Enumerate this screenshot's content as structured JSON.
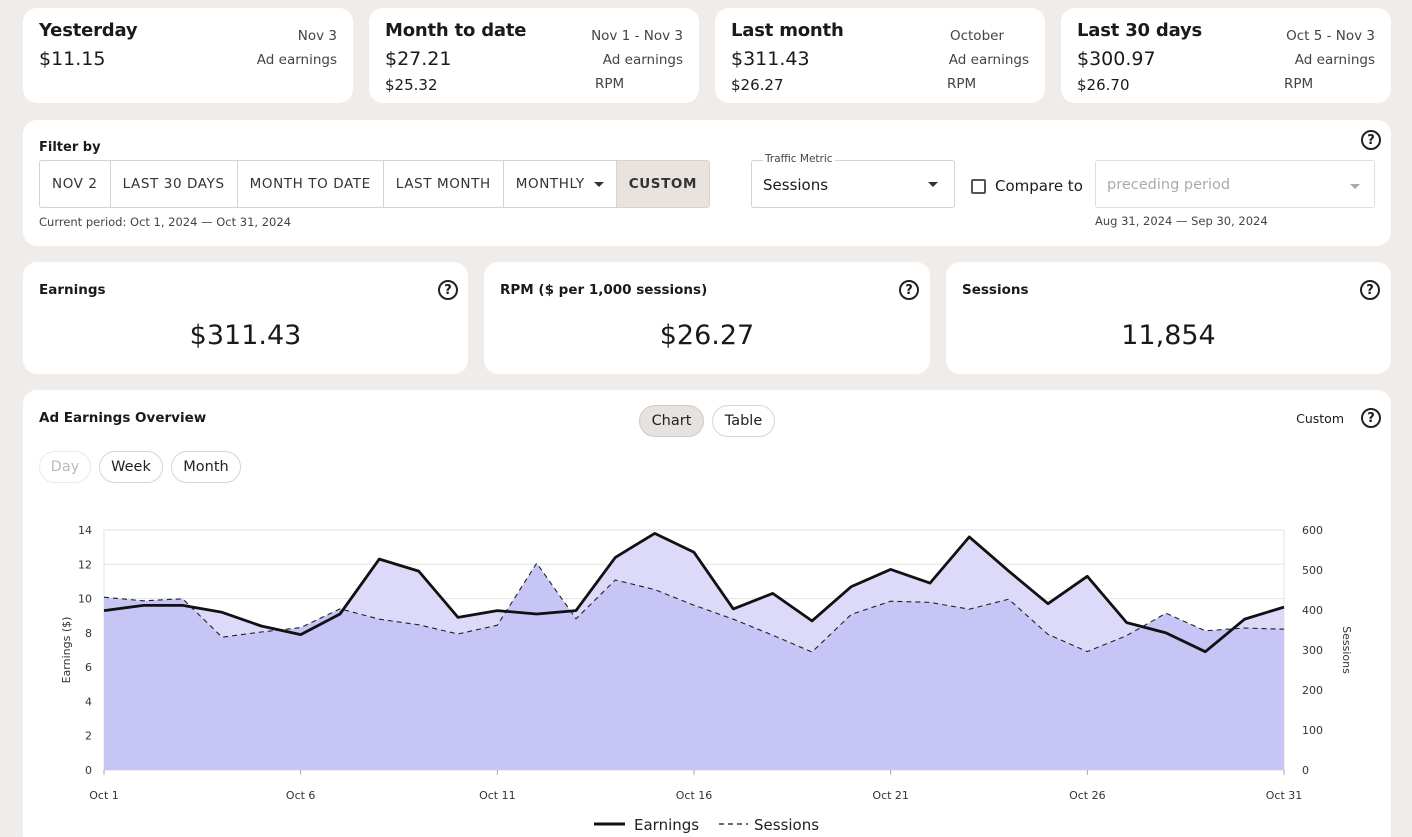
{
  "stats": [
    {
      "title": "Yesterday",
      "value1": "$11.15",
      "value2": "",
      "right0": "Nov 3",
      "right1": "Ad earnings",
      "right2": ""
    },
    {
      "title": "Month to date",
      "value1": "$27.21",
      "value2": "$25.32",
      "right0": "Nov 1 - Nov 3",
      "right1": "Ad earnings",
      "right2": "RPM"
    },
    {
      "title": "Last month",
      "value1": "$311.43",
      "value2": "$26.27",
      "right0": "October",
      "right1": "Ad earnings",
      "right2": "RPM"
    },
    {
      "title": "Last 30 days",
      "value1": "$300.97",
      "value2": "$26.70",
      "right0": "Oct 5 - Nov 3",
      "right1": "Ad earnings",
      "right2": "RPM"
    }
  ],
  "filter": {
    "label": "Filter by",
    "buttons": [
      "NOV 2",
      "LAST 30 DAYS",
      "MONTH TO DATE",
      "LAST MONTH",
      "MONTHLY",
      "CUSTOM"
    ],
    "active": "CUSTOM",
    "current_period": "Current period: Oct 1, 2024 — Oct 31, 2024",
    "traffic_metric_label": "Traffic Metric",
    "traffic_metric_value": "Sessions",
    "compare_label": "Compare to",
    "compare_placeholder": "preceding period",
    "compare_period": "Aug 31, 2024 — Sep 30, 2024",
    "help": "?"
  },
  "kpis": [
    {
      "label": "Earnings",
      "value": "$311.43",
      "help": "?"
    },
    {
      "label": "RPM ($ per 1,000 sessions)",
      "value": "$26.27",
      "help": "?"
    },
    {
      "label": "Sessions",
      "value": "11,854",
      "help": "?"
    }
  ],
  "overview": {
    "title": "Ad Earnings Overview",
    "view_tabs": [
      "Chart",
      "Table"
    ],
    "active_view": "Chart",
    "granularity": [
      "Day",
      "Week",
      "Month"
    ],
    "disabled_granularity": "Day",
    "range_label": "Custom",
    "help": "?"
  },
  "colors": {
    "earnings_line": "#111111",
    "earnings_fill": "#dcdaf8",
    "sessions_fill": "#c6c5f6",
    "grid": "#e2e2e2"
  },
  "chart_data": {
    "type": "area",
    "x": [
      "Oct 1",
      "Oct 2",
      "Oct 3",
      "Oct 4",
      "Oct 5",
      "Oct 6",
      "Oct 7",
      "Oct 8",
      "Oct 9",
      "Oct 10",
      "Oct 11",
      "Oct 12",
      "Oct 13",
      "Oct 14",
      "Oct 15",
      "Oct 16",
      "Oct 17",
      "Oct 18",
      "Oct 19",
      "Oct 20",
      "Oct 21",
      "Oct 22",
      "Oct 23",
      "Oct 24",
      "Oct 25",
      "Oct 26",
      "Oct 27",
      "Oct 28",
      "Oct 29",
      "Oct 30",
      "Oct 31"
    ],
    "x_tick_labels": [
      "Oct 1",
      "Oct 6",
      "Oct 11",
      "Oct 16",
      "Oct 21",
      "Oct 26",
      "Oct 31"
    ],
    "series": [
      {
        "name": "Earnings",
        "axis": "left",
        "style": "solid",
        "values": [
          9.3,
          9.6,
          9.6,
          9.2,
          8.4,
          7.9,
          9.1,
          12.3,
          11.6,
          8.9,
          9.3,
          9.1,
          9.3,
          12.4,
          13.8,
          12.7,
          9.4,
          10.3,
          8.7,
          10.7,
          11.7,
          10.9,
          13.6,
          11.6,
          9.7,
          11.3,
          8.6,
          8.0,
          6.9,
          8.8,
          9.5
        ]
      },
      {
        "name": "Sessions",
        "axis": "right",
        "style": "dashed",
        "values": [
          432,
          423,
          428,
          332,
          345,
          356,
          403,
          377,
          363,
          340,
          362,
          517,
          378,
          475,
          451,
          412,
          377,
          337,
          295,
          389,
          422,
          419,
          402,
          427,
          339,
          296,
          336,
          392,
          348,
          355,
          352
        ]
      }
    ],
    "left_axis": {
      "label": "Earnings ($)",
      "range": [
        0,
        14
      ],
      "ticks": [
        0,
        2,
        4,
        6,
        8,
        10,
        12,
        14
      ]
    },
    "right_axis": {
      "label": "Sessions",
      "range": [
        0,
        600
      ],
      "ticks": [
        0,
        100,
        200,
        300,
        400,
        500,
        600
      ]
    },
    "grid": true,
    "legend": "bottom-center"
  }
}
